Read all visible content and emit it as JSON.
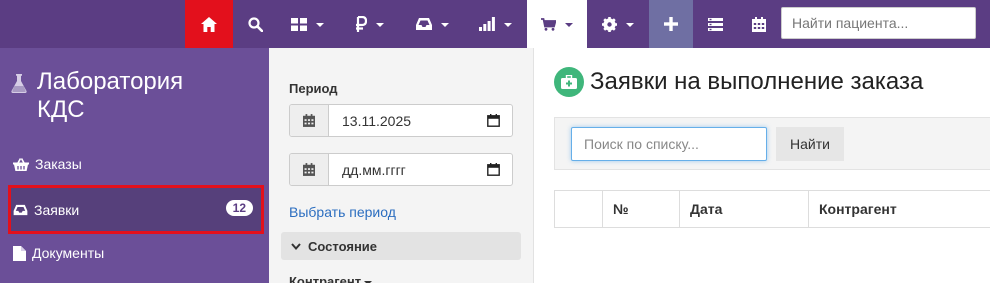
{
  "topnav": {
    "patient_search_placeholder": "Найти пациента..."
  },
  "sidebar": {
    "title": "Лаборатория КДС",
    "items": [
      {
        "label": "Заказы",
        "icon": "basket-icon"
      },
      {
        "label": "Заявки",
        "icon": "inbox-icon",
        "badge": "12",
        "active": true
      },
      {
        "label": "Документы",
        "icon": "document-icon"
      }
    ]
  },
  "filter": {
    "period_label": "Период",
    "date_from": "13.11.2025",
    "date_to": "дд.мм.гггг",
    "select_period_link": "Выбрать период",
    "state_label": "Состояние",
    "contractor_label": "Контрагент"
  },
  "main": {
    "title": "Заявки на выполнение заказа",
    "list_search_placeholder": "Поиск по списку...",
    "find_button": "Найти",
    "table_headers": [
      "№",
      "Дата",
      "Контрагент"
    ]
  },
  "colors": {
    "nav_bg": "#5b3d83",
    "sidebar_bg": "#6b4f98",
    "home_active": "#e3101c",
    "highlight_outline": "#e3101c",
    "link": "#2c6ec0",
    "med_icon": "#3fb67b"
  }
}
